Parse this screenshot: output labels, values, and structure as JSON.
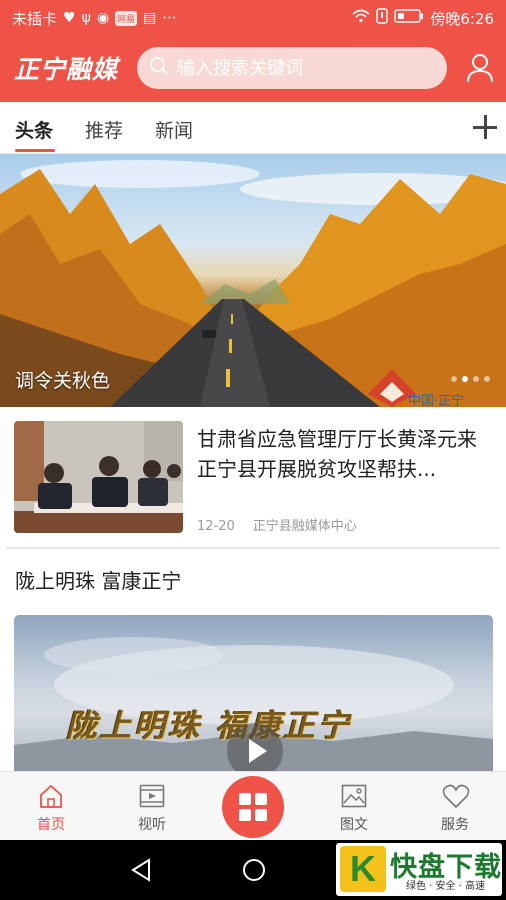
{
  "status_bar": {
    "carrier": "未插卡",
    "chip_label": "网易",
    "more": "···",
    "time": "傍晚6:26"
  },
  "header": {
    "logo": "正宁融媒",
    "search_placeholder": "输入搜索关键词"
  },
  "tabs": [
    {
      "label": "头条",
      "active": true
    },
    {
      "label": "推荐",
      "active": false
    },
    {
      "label": "新闻",
      "active": false
    }
  ],
  "banner": {
    "caption": "调令关秋色",
    "watermark": "中国·正宁",
    "slide_count": 4,
    "active_slide": 2
  },
  "news": [
    {
      "title": "甘肃省应急管理厅厅长黄泽元来正宁县开展脱贫攻坚帮扶...",
      "date": "12-20",
      "source": "正宁县融媒体中心"
    }
  ],
  "section": {
    "title": "陇上明珠 富康正宁",
    "video_overlay_text": "陇上明珠 福康正宁"
  },
  "bottom_nav": [
    {
      "label": "首页",
      "icon": "home-icon",
      "active": true
    },
    {
      "label": "视听",
      "icon": "video-icon",
      "active": false
    },
    {
      "label": "图文",
      "icon": "image-icon",
      "active": false
    },
    {
      "label": "服务",
      "icon": "heart-icon",
      "active": false
    }
  ],
  "watermark": {
    "title": "快盘下载",
    "subtitle": "绿色 · 安全 · 高速"
  },
  "colors": {
    "accent": "#ef5247",
    "text": "#222222",
    "muted": "#999999"
  }
}
